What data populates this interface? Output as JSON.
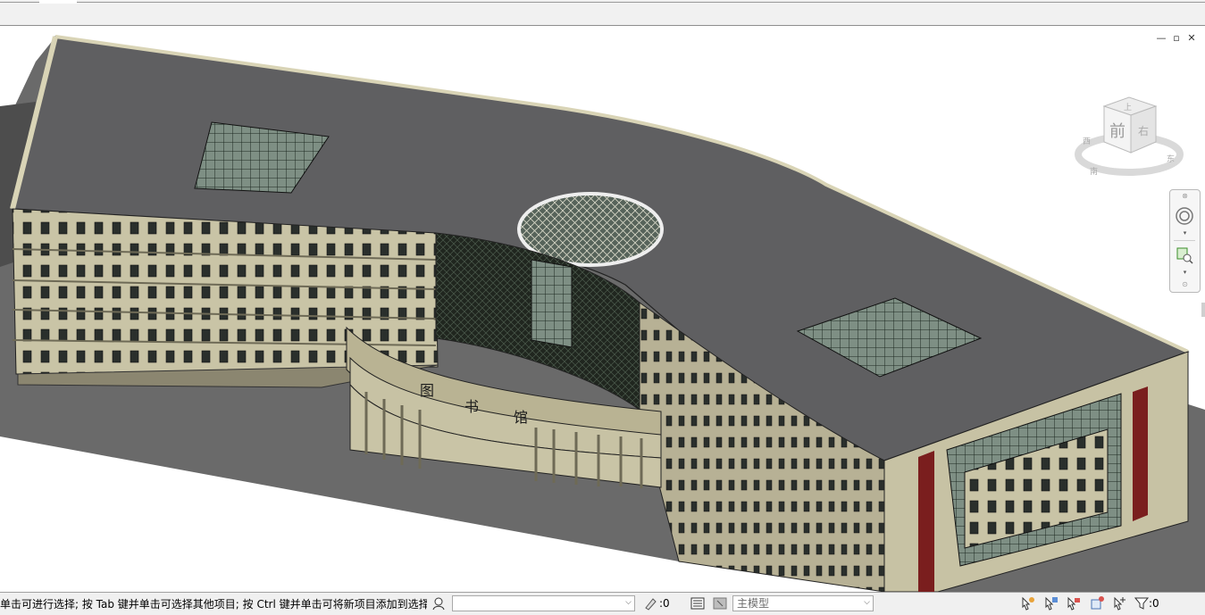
{
  "window": {
    "minimize_glyph": "—",
    "restore_glyph": "▫",
    "close_glyph": "✕"
  },
  "model": {
    "building_sign": [
      "图",
      "书",
      "馆"
    ],
    "colors": {
      "roof": "#5f5f61",
      "ground": "#6a6a6a",
      "wall": "#c7c2a4",
      "wall_shadow": "#a9a38a",
      "glass": "#3d4e46",
      "accent_red": "#7a1e1e"
    }
  },
  "viewcube": {
    "face_label": "前",
    "top_label": "上",
    "right_label": "右",
    "compass_labels": [
      "东",
      "南",
      "西"
    ]
  },
  "statusbar": {
    "hint": "单击可进行选择; 按 Tab 键并单击可选择其他项目; 按 Ctrl 键并单击可将新项目添加到选择",
    "workset_value": "",
    "editable_count": ":0",
    "model_combo": "主模型",
    "filter_count": ":0"
  }
}
